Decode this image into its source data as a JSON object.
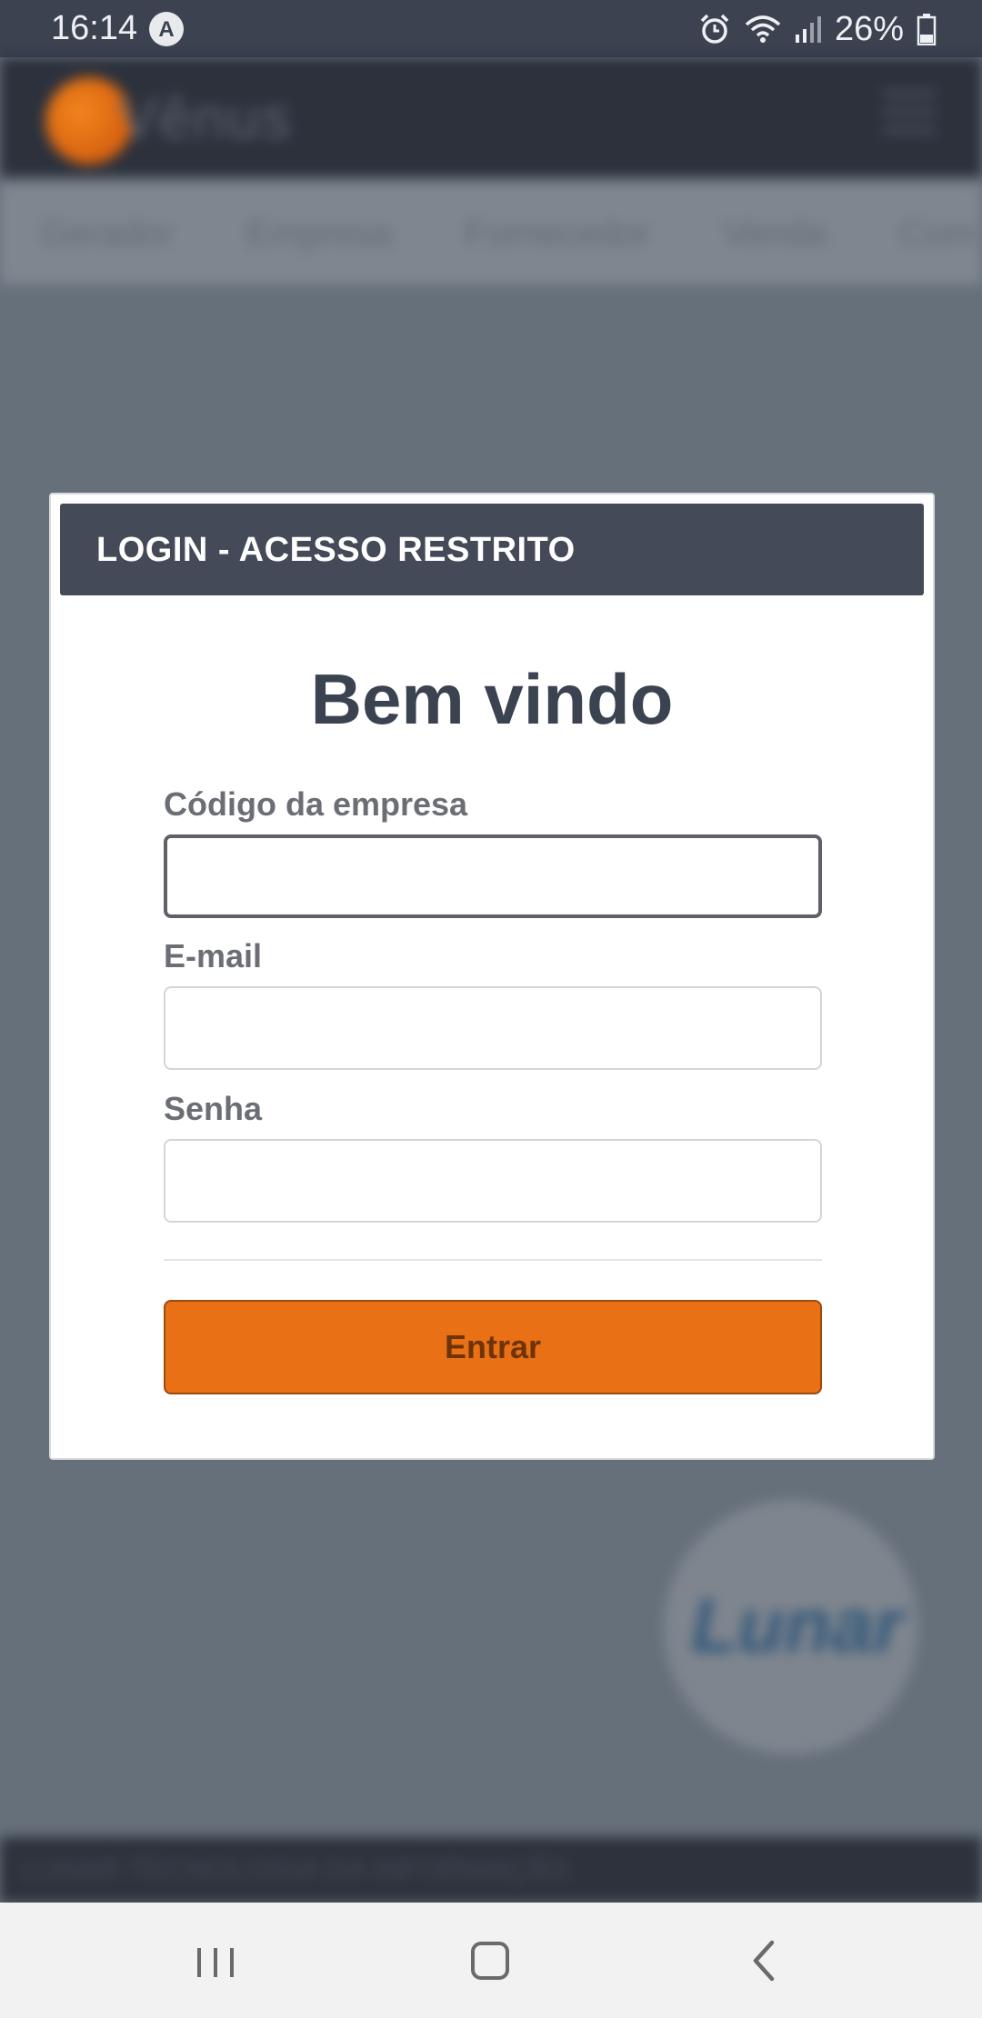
{
  "status_bar": {
    "time": "16:14",
    "launcher_icon": "a-icon",
    "alarm_icon": "alarm-icon",
    "wifi_icon": "wifi-icon",
    "signal_icon": "signal-icon",
    "battery_percent": "26%",
    "battery_icon": "battery-icon"
  },
  "background_app": {
    "logo_text": "Vênus",
    "nav_items": [
      "Gerador",
      "Empresa",
      "Fornecedor",
      "Venda",
      "Com"
    ],
    "footer_text": "LUNAR TECNOLOGIA DA INFORMAÇÃO",
    "badge_text": "Lunar"
  },
  "modal": {
    "header_title": "LOGIN - ACESSO RESTRITO",
    "welcome": "Bem vindo",
    "fields": [
      {
        "label": "Código da empresa",
        "value": "",
        "placeholder": ""
      },
      {
        "label": "E-mail",
        "value": "",
        "placeholder": ""
      },
      {
        "label": "Senha",
        "value": "",
        "placeholder": ""
      }
    ],
    "submit_label": "Entrar"
  },
  "colors": {
    "header_bg": "#444a57",
    "accent": "#ea7016",
    "title_text": "#3b4250"
  },
  "nav_bar": {
    "recents_icon": "recents-icon",
    "home_icon": "home-icon",
    "back_icon": "back-icon"
  }
}
